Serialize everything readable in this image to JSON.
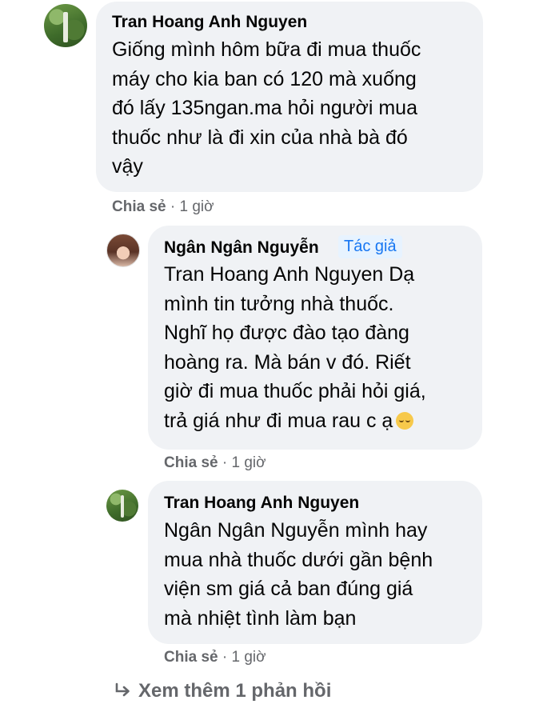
{
  "comments": [
    {
      "author": "Tran Hoang Anh Nguyen",
      "lines": [
        "Giống mình hôm bữa đi mua thuốc",
        "máy cho kia ban có 120 mà xuống",
        "đó lấy 135ngan.ma hỏi người mua",
        "thuốc như là đi xin của nhà bà đó",
        "vậy"
      ],
      "share_label": "Chia sẻ",
      "time": "· 1 giờ"
    },
    {
      "author": "Ngân Ngân Nguyễn",
      "badge": "Tác giả",
      "lines": [
        "Tran Hoang Anh Nguyen Dạ",
        "mình tin tưởng nhà thuốc.",
        "Nghĩ họ được đào tạo đàng",
        "hoàng ra. Mà bán v đó. Riết",
        "giờ đi mua thuốc phải hỏi giá,",
        "trả giá như đi mua rau c ạ"
      ],
      "emoji": "pensive-face",
      "share_label": "Chia sẻ",
      "time": "· 1 giờ"
    },
    {
      "author": "Tran Hoang Anh Nguyen",
      "lines": [
        "Ngân Ngân Nguyễn mình hay",
        "mua nhà thuốc dưới gần bệnh",
        "viện sm giá cả ban đúng giá",
        "mà nhiệt tình làm bạn"
      ],
      "share_label": "Chia sẻ",
      "time": "· 1 giờ"
    }
  ],
  "view_more": {
    "icon": "reply-arrow-icon",
    "label": "Xem thêm 1 phản hồi"
  }
}
